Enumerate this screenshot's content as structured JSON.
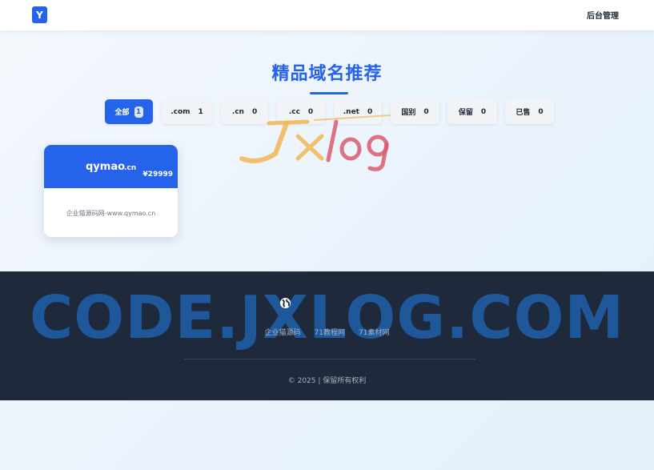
{
  "header": {
    "logo_letter": "Y",
    "admin_link": "后台管理"
  },
  "main": {
    "title": "精品域名推荐",
    "filters": [
      {
        "label": "全部",
        "count": "1",
        "active": true
      },
      {
        "label": ".com",
        "count": "1",
        "active": false
      },
      {
        "label": ".cn",
        "count": "0",
        "active": false
      },
      {
        "label": ".cc",
        "count": "0",
        "active": false
      },
      {
        "label": ".net",
        "count": "0",
        "active": false
      },
      {
        "label": "国别",
        "count": "0",
        "active": false
      },
      {
        "label": "保留",
        "count": "0",
        "active": false
      },
      {
        "label": "已售",
        "count": "0",
        "active": false
      }
    ],
    "card": {
      "domain": "qymao",
      "tld": ".cn",
      "price": "¥29999",
      "description": "企业猫源码网-www.qymao.cn"
    }
  },
  "watermark": {
    "logo_text": "Jxlog",
    "site_text": "CODE.JXLOG.COM"
  },
  "footer": {
    "links": [
      "企业猫源码",
      "71教程网",
      "71素材网"
    ],
    "copyright": "© 2025 | 保留所有权利"
  },
  "colors": {
    "accent": "#2563eb",
    "footer_bg": "#1e293b",
    "watermark_blue": "#1f5fa8"
  },
  "icons": {
    "globe": "globe-icon"
  }
}
